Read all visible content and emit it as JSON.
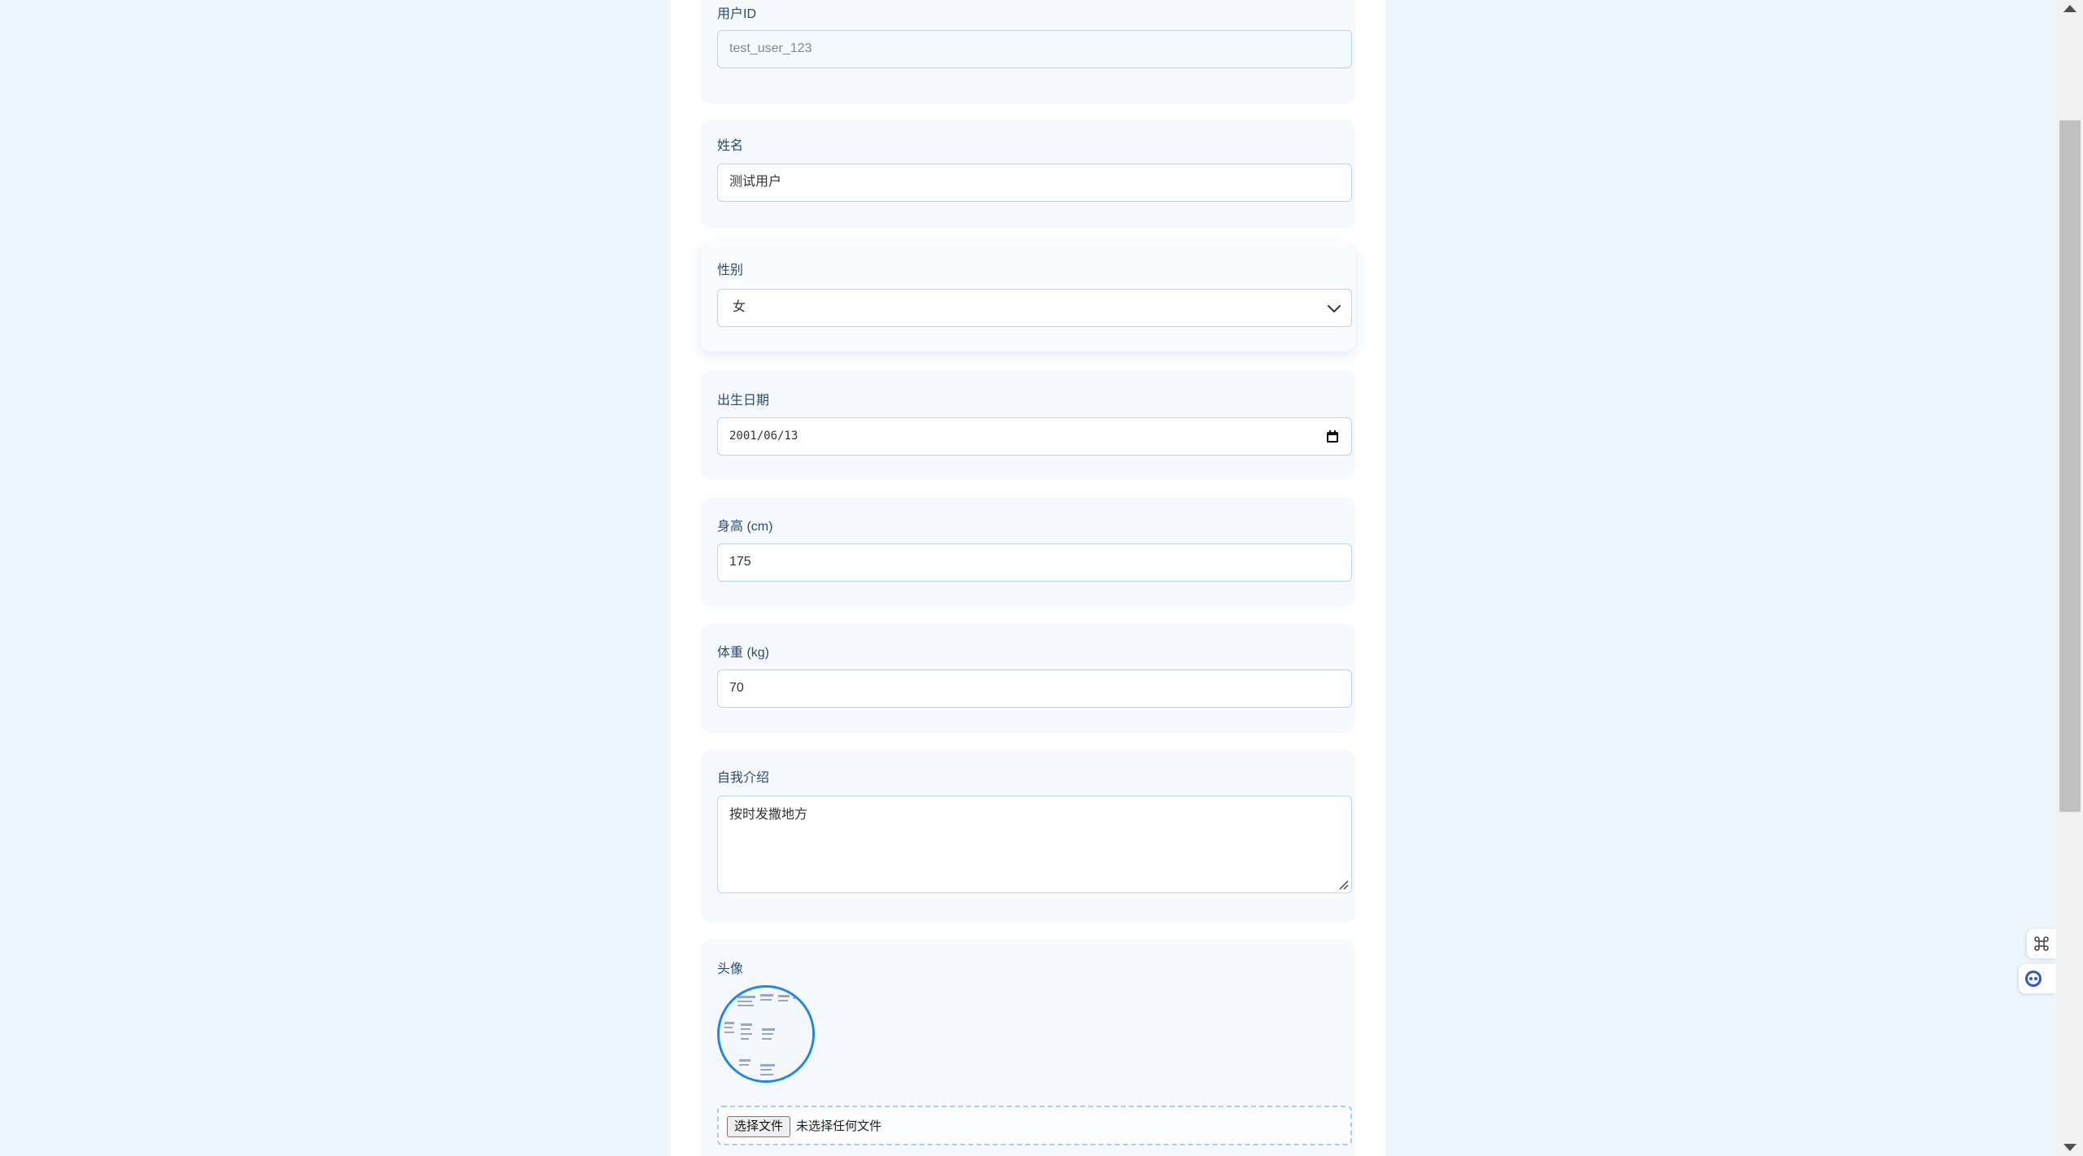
{
  "form": {
    "user_id": {
      "label": "用户ID",
      "value": "test_user_123"
    },
    "name": {
      "label": "姓名",
      "value": "测试用户"
    },
    "gender": {
      "label": "性别",
      "value": "女"
    },
    "birthdate": {
      "label": "出生日期",
      "value": "2001/06/13"
    },
    "height": {
      "label": "身高 (cm)",
      "value": "175"
    },
    "weight": {
      "label": "体重 (kg)",
      "value": "70"
    },
    "bio": {
      "label": "自我介绍",
      "value": "按时发撒地方"
    },
    "avatar": {
      "label": "头像",
      "choose_button": "选择文件",
      "file_status": "未选择任何文件"
    }
  },
  "icons": {
    "select": "chevron-down-icon",
    "date": "calendar-icon",
    "resize": "resize-handle-icon",
    "float_top": "command-icon",
    "float_bottom": "assistant-icon"
  },
  "colors": {
    "background": "#eef6fd",
    "card": "#f6faff",
    "border": "#b7d5ee",
    "accent": "#1e88e5",
    "label": "#2c4b6b"
  }
}
